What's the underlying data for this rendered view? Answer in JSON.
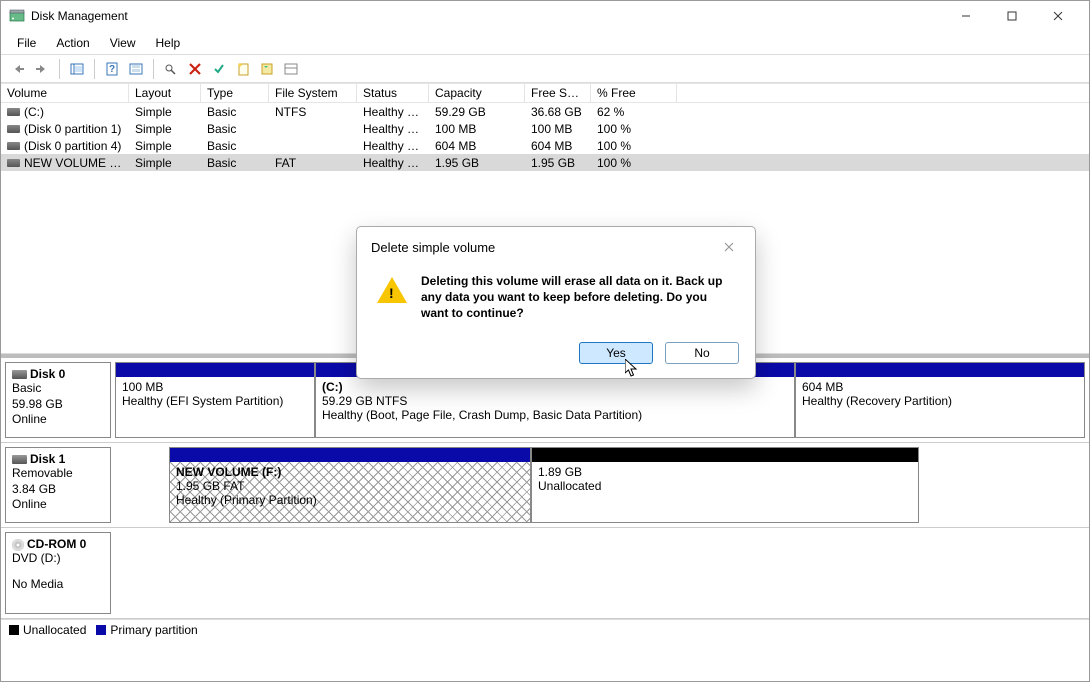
{
  "window": {
    "title": "Disk Management"
  },
  "menus": {
    "file": "File",
    "action": "Action",
    "view": "View",
    "help": "Help"
  },
  "table": {
    "headers": {
      "volume": "Volume",
      "layout": "Layout",
      "type": "Type",
      "fs": "File System",
      "status": "Status",
      "capacity": "Capacity",
      "free": "Free Spa...",
      "pct": "% Free"
    },
    "rows": [
      {
        "volume": "(C:)",
        "layout": "Simple",
        "type": "Basic",
        "fs": "NTFS",
        "status": "Healthy (B...",
        "capacity": "59.29 GB",
        "free": "36.68 GB",
        "pct": "62 %"
      },
      {
        "volume": "(Disk 0 partition 1)",
        "layout": "Simple",
        "type": "Basic",
        "fs": "",
        "status": "Healthy (E...",
        "capacity": "100 MB",
        "free": "100 MB",
        "pct": "100 %"
      },
      {
        "volume": "(Disk 0 partition 4)",
        "layout": "Simple",
        "type": "Basic",
        "fs": "",
        "status": "Healthy (R...",
        "capacity": "604 MB",
        "free": "604 MB",
        "pct": "100 %"
      },
      {
        "volume": "NEW VOLUME  (F:)",
        "layout": "Simple",
        "type": "Basic",
        "fs": "FAT",
        "status": "Healthy (P...",
        "capacity": "1.95 GB",
        "free": "1.95 GB",
        "pct": "100 %"
      }
    ]
  },
  "disks": {
    "d0": {
      "name": "Disk 0",
      "type": "Basic",
      "size": "59.98 GB",
      "state": "Online",
      "p0": {
        "name": "",
        "line2": "100 MB",
        "line3": "Healthy (EFI System Partition)"
      },
      "p1": {
        "name": "(C:)",
        "line2": "59.29 GB NTFS",
        "line3": "Healthy (Boot, Page File, Crash Dump, Basic Data Partition)"
      },
      "p2": {
        "name": "",
        "line2": "604 MB",
        "line3": "Healthy (Recovery Partition)"
      }
    },
    "d1": {
      "name": "Disk 1",
      "type": "Removable",
      "size": "3.84 GB",
      "state": "Online",
      "p0": {
        "name": "NEW VOLUME  (F:)",
        "line2": "1.95 GB FAT",
        "line3": "Healthy (Primary Partition)"
      },
      "p1": {
        "name": "",
        "line2": "1.89 GB",
        "line3": "Unallocated"
      }
    },
    "cd": {
      "name": "CD-ROM 0",
      "type": "DVD (D:)",
      "state": "No Media"
    }
  },
  "legend": {
    "unalloc": "Unallocated",
    "primary": "Primary partition"
  },
  "dialog": {
    "title": "Delete simple volume",
    "message": "Deleting this volume will erase all data on it. Back up any data you want to keep before deleting. Do you want to continue?",
    "yes": "Yes",
    "no": "No"
  }
}
